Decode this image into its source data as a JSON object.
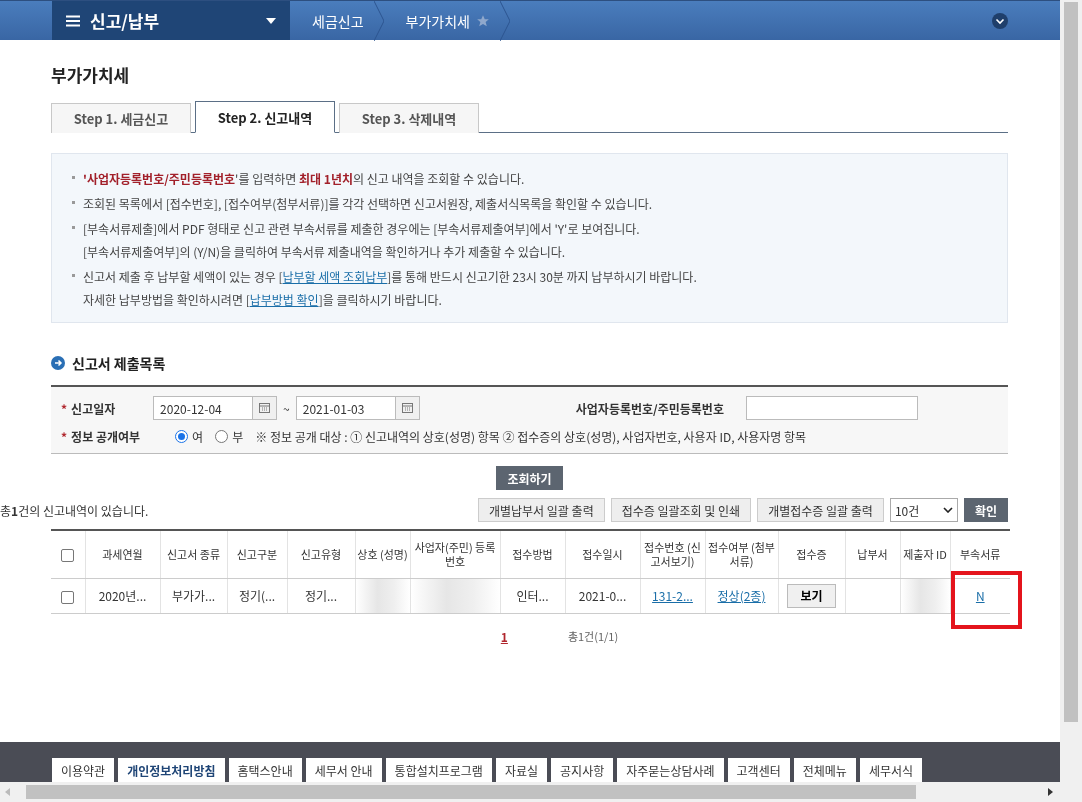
{
  "top_bar": {
    "menu_title": "신고/납부",
    "breadcrumbs": [
      {
        "label": "세금신고",
        "favorite": false
      },
      {
        "label": "부가가치세",
        "favorite": true
      }
    ]
  },
  "page_title": "부가가치세",
  "tabs": [
    {
      "label": "Step 1. 세금신고",
      "selected": false
    },
    {
      "label": "Step 2. 신고내역",
      "selected": true
    },
    {
      "label": "Step 3. 삭제내역",
      "selected": false
    }
  ],
  "notices": [
    {
      "lines": [
        [
          {
            "kind": "strong",
            "text": "'"
          },
          {
            "kind": "strong",
            "text": "사업자등록번호/주민등록번호"
          },
          {
            "kind": "plain",
            "text": "'를 입력하면 "
          },
          {
            "kind": "strong",
            "text": "최대 1년치"
          },
          {
            "kind": "plain",
            "text": "의 신고 내역을 조회할 수 있습니다."
          }
        ]
      ]
    },
    {
      "lines": [
        [
          {
            "kind": "plain",
            "text": "조회된 목록에서 [접수번호], [접수여부(첨부서류)]를 각각 선택하면 신고서원장, 제출서식목록을 확인할 수 있습니다."
          }
        ]
      ]
    },
    {
      "lines": [
        [
          {
            "kind": "plain",
            "text": "[부속서류제출]에서 PDF 형태로 신고 관련 부속서류를 제출한 경우에는 [부속서류제출여부]에서 'Y'로 보여집니다."
          }
        ],
        [
          {
            "kind": "plain",
            "text": "[부속서류제출여부]의 (Y/N)을 클릭하여 부속서류 제출내역을 확인하거나 추가 제출할 수 있습니다."
          }
        ]
      ]
    },
    {
      "lines": [
        [
          {
            "kind": "plain",
            "text": "신고서 제출 후 납부할 세액이 있는 경우 ["
          },
          {
            "kind": "link",
            "text": "납부할 세액 조회납부"
          },
          {
            "kind": "plain",
            "text": "]를 통해 반드시 신고기한 23시 30분 까지 납부하시기 바랍니다."
          }
        ],
        [
          {
            "kind": "plain",
            "text": "자세한 납부방법을 확인하시려면 ["
          },
          {
            "kind": "link",
            "text": "납부방법 확인"
          },
          {
            "kind": "plain",
            "text": "]을 클릭하시기 바랍니다."
          }
        ]
      ]
    }
  ],
  "section_title": "신고서 제출목록",
  "search_form": {
    "required_mark": "*",
    "date_label": "신고일자",
    "date_from": "2020-12-04",
    "date_separator": "~",
    "date_to": "2021-01-03",
    "id_label": "사업자등록번호/주민등록번호",
    "disclosure_label": "정보 공개여부",
    "disclosure_options": [
      {
        "label": "여",
        "selected": true
      },
      {
        "label": "부",
        "selected": false
      }
    ],
    "disclosure_note": "※ 정보 공개 대상 : ① 신고내역의 상호(성명) 항목 ② 접수증의 상호(성명), 사업자번호, 사용자 ID, 사용자명 항목",
    "search_button": "조회하기"
  },
  "result_summary": "총**1**건의 신고내역이 있습니다.",
  "actions": [
    "개별납부서 일괄 출력",
    "접수증 일괄조회 및 인쇄",
    "개별접수증 일괄 출력"
  ],
  "page_size": "10건",
  "confirm_button": "확인",
  "table": {
    "all_checked": false,
    "columns": [
      "과세연월",
      "신고서 종류",
      "신고구분",
      "신고유형",
      "상호 (성명)",
      "사업자(주민) 등록번호",
      "접수방법",
      "접수일시",
      "접수번호 (신고서보기)",
      "접수여부 (첨부서류)",
      "접수증",
      "납부서",
      "제출자 ID",
      "부속서류"
    ],
    "rows": [
      {
        "checked": false,
        "cells": [
          {
            "kind": "text",
            "text": "2020년..."
          },
          {
            "kind": "text",
            "text": "부가가..."
          },
          {
            "kind": "text",
            "text": "정기(..."
          },
          {
            "kind": "text",
            "text": "정기..."
          },
          {
            "kind": "redacted"
          },
          {
            "kind": "redacted"
          },
          {
            "kind": "text",
            "text": "인터..."
          },
          {
            "kind": "text",
            "text": "2021-0..."
          },
          {
            "kind": "link",
            "text": "131-2..."
          },
          {
            "kind": "link",
            "text": "정상(2종)"
          },
          {
            "kind": "button",
            "text": "보기"
          },
          {
            "kind": "empty"
          },
          {
            "kind": "redacted"
          },
          {
            "kind": "link",
            "text": "N",
            "highlighted": true
          }
        ]
      }
    ]
  },
  "pagination": {
    "pages": [
      {
        "label": "1",
        "selected": true
      }
    ],
    "summary": "총1건(1/1)"
  },
  "footer_links": [
    {
      "label": "이용약관",
      "highlighted": false
    },
    {
      "label": "개인정보처리방침",
      "highlighted": true
    },
    {
      "label": "홈택스안내",
      "highlighted": false
    },
    {
      "label": "세무서 안내",
      "highlighted": false
    },
    {
      "label": "통합설치프로그램",
      "highlighted": false
    },
    {
      "label": "자료실",
      "highlighted": false
    },
    {
      "label": "공지사항",
      "highlighted": false
    },
    {
      "label": "자주묻는상담사례",
      "highlighted": false
    },
    {
      "label": "고객센터",
      "highlighted": false
    },
    {
      "label": "전체메뉴",
      "highlighted": false
    },
    {
      "label": "세무서식",
      "highlighted": false
    }
  ]
}
